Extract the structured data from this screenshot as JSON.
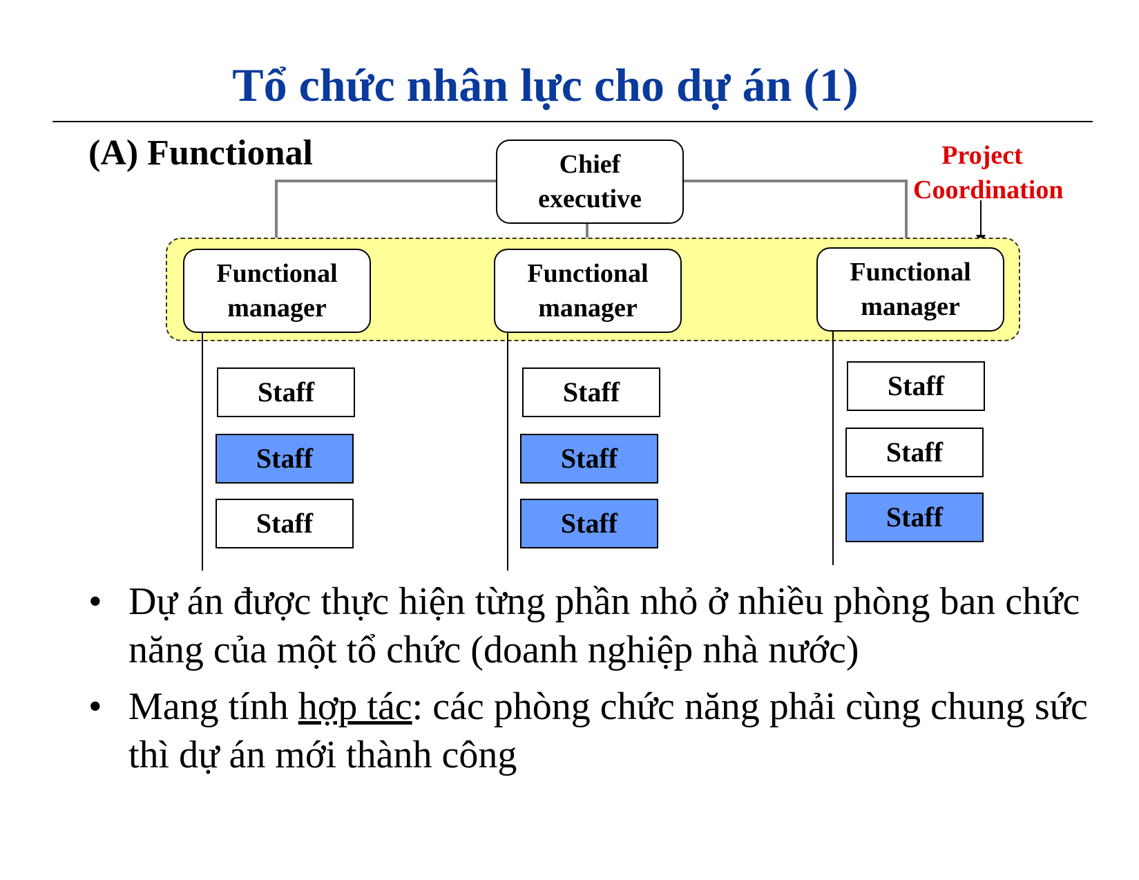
{
  "slide": {
    "title": "Tổ chức nhân lực cho dự án (1)",
    "subtitle": "(A) Functional",
    "annotation": {
      "line1": "Project",
      "line2": "Coordination",
      "color": "#e00000"
    },
    "title_color": "#0a3a9c"
  },
  "diagram": {
    "chief": {
      "line1": "Chief",
      "line2": "executive"
    },
    "band_color": "#ffff99",
    "highlight_color": "#6699ff",
    "managers": [
      {
        "line1": "Functional",
        "line2": "manager",
        "staff": [
          {
            "label": "Staff",
            "highlighted": false
          },
          {
            "label": "Staff",
            "highlighted": true
          },
          {
            "label": "Staff",
            "highlighted": false
          }
        ]
      },
      {
        "line1": "Functional",
        "line2": "manager",
        "staff": [
          {
            "label": "Staff",
            "highlighted": false
          },
          {
            "label": "Staff",
            "highlighted": true
          },
          {
            "label": "Staff",
            "highlighted": true
          }
        ]
      },
      {
        "line1": "Functional",
        "line2": "manager",
        "staff": [
          {
            "label": "Staff",
            "highlighted": false
          },
          {
            "label": "Staff",
            "highlighted": false
          },
          {
            "label": "Staff",
            "highlighted": true
          }
        ]
      }
    ]
  },
  "bullets": [
    {
      "marker": "•",
      "text": "Dự án được thực hiện từng phần nhỏ ở nhiều phòng ban chức năng của một tổ chức (doanh nghiệp nhà nước)"
    },
    {
      "marker": "•",
      "pre": "Mang tính ",
      "underlined": "hợp tác",
      "post": ": các phòng chức năng phải cùng chung sức thì dự án mới thành công"
    }
  ]
}
